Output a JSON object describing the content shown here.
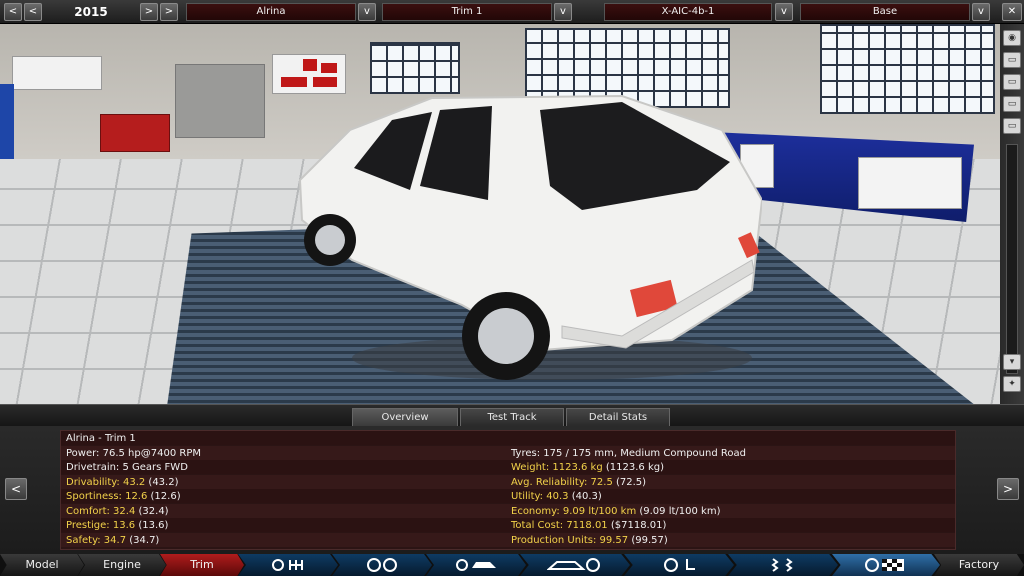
{
  "top_bar": {
    "year": "2015",
    "prev_icon": "chevron-left-icon",
    "next_icon": "chevron-right-icon",
    "model": "Alrina",
    "trim": "Trim 1",
    "engine": "X-AIC-4b-1",
    "variant": "Base",
    "dropdown_label": "v",
    "close_icon": "close-icon"
  },
  "tabs": [
    {
      "label": "Overview",
      "active": true
    },
    {
      "label": "Test Track",
      "active": false
    },
    {
      "label": "Detail Stats",
      "active": false
    }
  ],
  "stats": {
    "title": "Alrina - Trim 1",
    "left": [
      {
        "label": "Power:",
        "value": "76.5 hp@7400 RPM",
        "paren": "",
        "color": "white"
      },
      {
        "label": "Drivetrain:",
        "value": "5 Gears FWD",
        "paren": "",
        "color": "white"
      },
      {
        "label": "Drivability:",
        "value": "43.2",
        "paren": "(43.2)",
        "color": "yellow"
      },
      {
        "label": "Sportiness:",
        "value": "12.6",
        "paren": "(12.6)",
        "color": "yellow"
      },
      {
        "label": "Comfort:",
        "value": "32.4",
        "paren": "(32.4)",
        "color": "yellow"
      },
      {
        "label": "Prestige:",
        "value": "13.6",
        "paren": "(13.6)",
        "color": "yellow"
      },
      {
        "label": "Safety:",
        "value": "34.7",
        "paren": "(34.7)",
        "color": "yellow"
      }
    ],
    "right": [
      {
        "label": "Tyres:",
        "value": "175 / 175 mm, Medium Compound Road",
        "paren": "",
        "color": "white"
      },
      {
        "label": "Weight:",
        "value": "1123.6 kg",
        "paren": "(1123.6 kg)",
        "color": "yellow"
      },
      {
        "label": "Avg. Reliability:",
        "value": "72.5",
        "paren": "(72.5)",
        "color": "yellow"
      },
      {
        "label": "Utility:",
        "value": "40.3",
        "paren": "(40.3)",
        "color": "yellow"
      },
      {
        "label": "Economy:",
        "value": "9.09 lt/100 km",
        "paren": "(9.09 lt/100 km)",
        "color": "yellow"
      },
      {
        "label": "Total Cost:",
        "value": "7118.01",
        "paren": "($7118.01)",
        "color": "yellow"
      },
      {
        "label": "Production Units:",
        "value": "99.57",
        "paren": "(99.57)",
        "color": "yellow"
      }
    ]
  },
  "panel_nav": {
    "left": "<",
    "right": ">"
  },
  "bottom_nav": [
    {
      "label": "Model",
      "type": "text"
    },
    {
      "label": "Engine",
      "type": "text"
    },
    {
      "label": "Trim",
      "type": "active"
    },
    {
      "label": "",
      "type": "icon",
      "icon": "gearbox-icon"
    },
    {
      "label": "",
      "type": "icon",
      "icon": "wheels-icon"
    },
    {
      "label": "",
      "type": "icon",
      "icon": "body-icon"
    },
    {
      "label": "",
      "type": "icon",
      "icon": "car-fan-icon"
    },
    {
      "label": "",
      "type": "icon",
      "icon": "steering-seat-icon"
    },
    {
      "label": "",
      "type": "icon",
      "icon": "suspension-icon"
    },
    {
      "label": "",
      "type": "icon-sel",
      "icon": "test-flag-icon"
    },
    {
      "label": "Factory",
      "type": "text"
    }
  ],
  "colors": {
    "accent_red": "#b01c1c",
    "stat_yellow": "#f2d24a",
    "icon_blue": "#0e3b63"
  }
}
